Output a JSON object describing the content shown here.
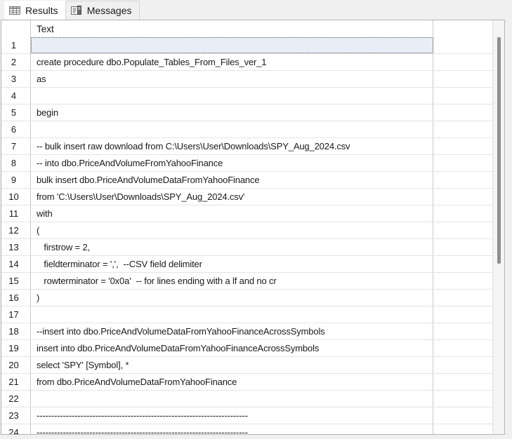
{
  "window": {
    "background_color": "#f0f0f0"
  },
  "tabs": [
    {
      "id": "results",
      "label": "Results",
      "icon": "grid-table-icon",
      "active": true
    },
    {
      "id": "messages",
      "label": "Messages",
      "icon": "message-document-icon",
      "active": false
    }
  ],
  "grid": {
    "columns": [
      {
        "key": "rownum",
        "label": ""
      },
      {
        "key": "text",
        "label": "Text"
      }
    ],
    "selected_row": 1,
    "rows": [
      {
        "n": "1",
        "text": ""
      },
      {
        "n": "2",
        "text": "create procedure dbo.Populate_Tables_From_Files_ver_1"
      },
      {
        "n": "3",
        "text": "as"
      },
      {
        "n": "4",
        "text": ""
      },
      {
        "n": "5",
        "text": "begin"
      },
      {
        "n": "6",
        "text": ""
      },
      {
        "n": "7",
        "text": "-- bulk insert raw download from C:\\Users\\User\\Downloads\\SPY_Aug_2024.csv"
      },
      {
        "n": "8",
        "text": "-- into dbo.PriceAndVolumeFromYahooFinance"
      },
      {
        "n": "9",
        "text": "bulk insert dbo.PriceAndVolumeDataFromYahooFinance"
      },
      {
        "n": "10",
        "text": "from 'C:\\Users\\User\\Downloads\\SPY_Aug_2024.csv'"
      },
      {
        "n": "11",
        "text": "with"
      },
      {
        "n": "12",
        "text": "("
      },
      {
        "n": "13",
        "text": "   firstrow = 2,"
      },
      {
        "n": "14",
        "text": "   fieldterminator = ',',  --CSV field delimiter"
      },
      {
        "n": "15",
        "text": "   rowterminator = '0x0a'  -- for lines ending with a lf and no cr"
      },
      {
        "n": "16",
        "text": ")"
      },
      {
        "n": "17",
        "text": ""
      },
      {
        "n": "18",
        "text": "--insert into dbo.PriceAndVolumeDataFromYahooFinanceAcrossSymbols"
      },
      {
        "n": "19",
        "text": "insert into dbo.PriceAndVolumeDataFromYahooFinanceAcrossSymbols"
      },
      {
        "n": "20",
        "text": "select 'SPY' [Symbol], *"
      },
      {
        "n": "21",
        "text": "from dbo.PriceAndVolumeDataFromYahooFinance"
      },
      {
        "n": "22",
        "text": ""
      },
      {
        "n": "23",
        "text": "------------------------------------------------------------------------"
      },
      {
        "n": "24",
        "text": "------------------------------------------------------------------------"
      }
    ]
  },
  "scrollbar": {
    "orientation": "vertical",
    "thumb_color": "#8e8e8e",
    "track_color": "#f4f4f4"
  }
}
